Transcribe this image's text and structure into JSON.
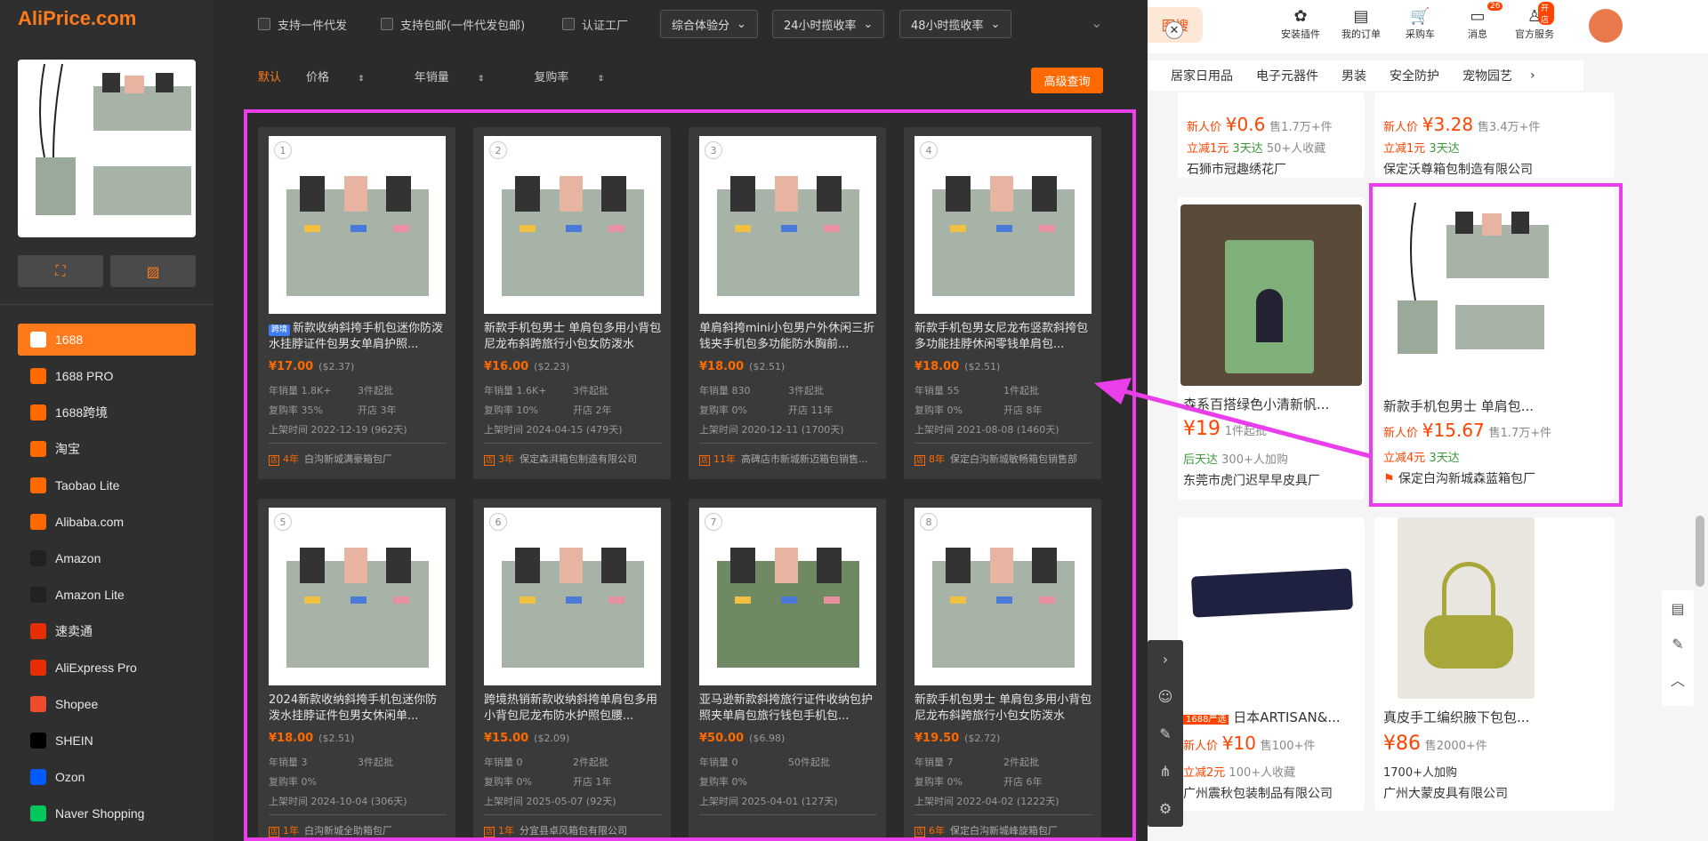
{
  "app": {
    "logo": "AliPrice.com"
  },
  "sidebar": {
    "platforms": [
      {
        "label": "1688",
        "icon": "1688-icon",
        "color": "#ff6a00",
        "active": true
      },
      {
        "label": "1688 PRO",
        "icon": "1688-pro-icon",
        "color": "#ff6a00"
      },
      {
        "label": "1688跨境",
        "icon": "1688-crossborder-icon",
        "color": "#ff6a00"
      },
      {
        "label": "淘宝",
        "icon": "taobao-icon",
        "color": "#ff6a00"
      },
      {
        "label": "Taobao Lite",
        "icon": "taobao-lite-icon",
        "color": "#ff6a00"
      },
      {
        "label": "Alibaba.com",
        "icon": "alibaba-icon",
        "color": "#ff6a00"
      },
      {
        "label": "Amazon",
        "icon": "amazon-icon",
        "color": "#222222"
      },
      {
        "label": "Amazon Lite",
        "icon": "amazon-lite-icon",
        "color": "#222222"
      },
      {
        "label": "速卖通",
        "icon": "aliexpress-icon",
        "color": "#e62e04"
      },
      {
        "label": "AliExpress Pro",
        "icon": "aliexpress-pro-icon",
        "color": "#e62e04"
      },
      {
        "label": "Shopee",
        "icon": "shopee-icon",
        "color": "#ee4d2d"
      },
      {
        "label": "SHEIN",
        "icon": "shein-icon",
        "color": "#000000"
      },
      {
        "label": "Ozon",
        "icon": "ozon-icon",
        "color": "#005bff"
      },
      {
        "label": "Naver Shopping",
        "icon": "naver-icon",
        "color": "#03c75a"
      }
    ]
  },
  "filters": {
    "checkboxes": [
      "支持一件代发",
      "支持包邮(一件代发包邮)",
      "认证工厂"
    ],
    "dropdowns": [
      "综合体验分",
      "24小时揽收率",
      "48小时揽收率"
    ],
    "sort": [
      "默认",
      "价格",
      "年销量",
      "复购率"
    ],
    "advanced": "高级查询"
  },
  "results": [
    {
      "idx": "1",
      "tag": "跨境",
      "title": "新款收纳斜挎手机包迷你防泼水挂脖证件包男女单肩护照...",
      "price": "¥17.00",
      "usd": "($2.37)",
      "sales": "年销量 1.8K+",
      "moq": "3件起批",
      "repurchase": "复购率 35%",
      "open": "开店 3年",
      "listed": "上架时间 2022-12-19 (962天)",
      "years": "4年",
      "shop": "白沟新城满豪箱包厂"
    },
    {
      "idx": "2",
      "tag": "",
      "title": "新款手机包男士 单肩包多用小背包 尼龙布斜跨旅行小包女防泼水",
      "price": "¥16.00",
      "usd": "($2.23)",
      "sales": "年销量 1.6K+",
      "moq": "3件起批",
      "repurchase": "复购率 10%",
      "open": "开店 2年",
      "listed": "上架时间 2024-04-15 (479天)",
      "years": "3年",
      "shop": "保定森湃箱包制造有限公司"
    },
    {
      "idx": "3",
      "tag": "",
      "title": "单肩斜挎mini小包男户外休闲三折钱夹手机包多功能防水胸前...",
      "price": "¥18.00",
      "usd": "($2.51)",
      "sales": "年销量 830",
      "moq": "3件起批",
      "repurchase": "复购率 0%",
      "open": "开店 11年",
      "listed": "上架时间 2020-12-11 (1700天)",
      "years": "11年",
      "shop": "高碑店市新城新迈箱包销售..."
    },
    {
      "idx": "4",
      "tag": "",
      "title": "新款手机包男女尼龙布竖款斜挎包多功能挂脖休闲零钱单肩包...",
      "price": "¥18.00",
      "usd": "($2.51)",
      "sales": "年销量 55",
      "moq": "1件起批",
      "repurchase": "复购率 0%",
      "open": "开店 8年",
      "listed": "上架时间 2021-08-08 (1460天)",
      "years": "8年",
      "shop": "保定白沟新城敏畅箱包销售部"
    },
    {
      "idx": "5",
      "tag": "",
      "title": "2024新款收纳斜挎手机包迷你防泼水挂脖证件包男女休闲单...",
      "price": "¥18.00",
      "usd": "($2.51)",
      "sales": "年销量 3",
      "moq": "3件起批",
      "repurchase": "复购率 0%",
      "open": "",
      "listed": "上架时间 2024-10-04 (306天)",
      "years": "1年",
      "shop": "白沟新城全助箱包厂"
    },
    {
      "idx": "6",
      "tag": "",
      "title": "跨境热销新款收纳斜挎单肩包多用小背包尼龙布防水护照包腰...",
      "price": "¥15.00",
      "usd": "($2.09)",
      "sales": "年销量 0",
      "moq": "2件起批",
      "repurchase": "复购率 0%",
      "open": "开店 1年",
      "listed": "上架时间 2025-05-07 (92天)",
      "years": "1年",
      "shop": "分宜县卓风箱包有限公司"
    },
    {
      "idx": "7",
      "tag": "",
      "title": "亚马逊新款斜挎旅行证件收纳包护照夹单肩包旅行钱包手机包...",
      "price": "¥50.00",
      "usd": "($6.98)",
      "sales": "年销量 0",
      "moq": "50件起批",
      "repurchase": "复购率 0%",
      "open": "",
      "listed": "上架时间 2025-04-01 (127天)",
      "years": "",
      "shop": ""
    },
    {
      "idx": "8",
      "tag": "",
      "title": "新款手机包男士 单肩包多用小背包 尼龙布斜跨旅行小包女防泼水",
      "price": "¥19.50",
      "usd": "($2.72)",
      "sales": "年销量 7",
      "moq": "2件起批",
      "repurchase": "复购率 0%",
      "open": "开店 6年",
      "listed": "上架时间 2022-04-02 (1222天)",
      "years": "6年",
      "shop": "保定白沟新城峰旋箱包厂"
    }
  ],
  "background": {
    "top_icons": [
      "安装插件",
      "我的订单",
      "采购车",
      "消息",
      "官方服务"
    ],
    "msg_badge": "26",
    "service_badge": "开店",
    "search_btn": "图搜",
    "categories": [
      "居家日用品",
      "电子元器件",
      "男装",
      "安全防护",
      "宠物园艺"
    ],
    "row0": [
      {
        "newp": "新人价",
        "price": "¥0.6",
        "sold": "售1.7万+件",
        "save": "立减1元",
        "days": "3天达",
        "fav": "50+人收藏",
        "shop": "石狮市冠趣绣花厂"
      },
      {
        "newp": "新人价",
        "price": "¥3.28",
        "sold": "售3.4万+件",
        "save": "立减1元",
        "days": "3天达",
        "fav": "",
        "shop": "保定沃尊箱包制造有限公司"
      }
    ],
    "row1": [
      {
        "title": "森系百搭绿色小清新帆...",
        "price": "¥19",
        "sold": "1件起批",
        "days": "后天达",
        "fav": "300+人加购",
        "shop": "东莞市虎门迟早早皮具厂"
      },
      {
        "title": "新款手机包男士 单肩包...",
        "newp": "新人价",
        "price": "¥15.67",
        "sold": "售1.7万+件",
        "save": "立减4元",
        "days": "3天达",
        "shop": "保定白沟新城森蓝箱包厂"
      }
    ],
    "row2": [
      {
        "badge": "1688严选",
        "title": "日本ARTISAN&...",
        "newp": "新人价",
        "price": "¥10",
        "sold": "售100+件",
        "save": "立减2元",
        "fav": "100+人收藏",
        "shop": "广州震秋包装制品有限公司"
      },
      {
        "title": "真皮手工编织腋下包包...",
        "price": "¥86",
        "sold": "售2000+件",
        "fav": "1700+人加购",
        "shop": "广州大蒙皮具有限公司"
      }
    ]
  }
}
